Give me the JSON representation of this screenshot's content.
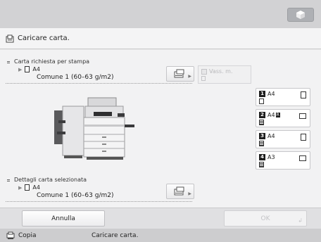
{
  "header": {
    "message": "Caricare carta."
  },
  "requested": {
    "label": "Carta richiesta per stampa",
    "size": "A4",
    "type": "Comune 1 (60–63 g/m2)"
  },
  "bypass": {
    "label": "Vass. m."
  },
  "selected": {
    "label": "Dettagli carta selezionata",
    "size": "A4",
    "type": "Comune 1 (60–63 g/m2)"
  },
  "drawers": [
    {
      "num": "1",
      "size": "A4",
      "badge": "",
      "orientation": "portrait"
    },
    {
      "num": "2",
      "size": "A4",
      "badge": "R",
      "orientation": "landscape"
    },
    {
      "num": "3",
      "size": "A4",
      "badge": "",
      "orientation": "portrait"
    },
    {
      "num": "4",
      "size": "A3",
      "badge": "",
      "orientation": "landscape"
    }
  ],
  "buttons": {
    "cancel": "Annulla",
    "ok": "OK"
  },
  "status": {
    "function": "Copia",
    "message": "Caricare carta."
  },
  "icons": {
    "top": "settings-cube-icon",
    "message": "paper-tray-icon",
    "status": "copy-icon"
  }
}
